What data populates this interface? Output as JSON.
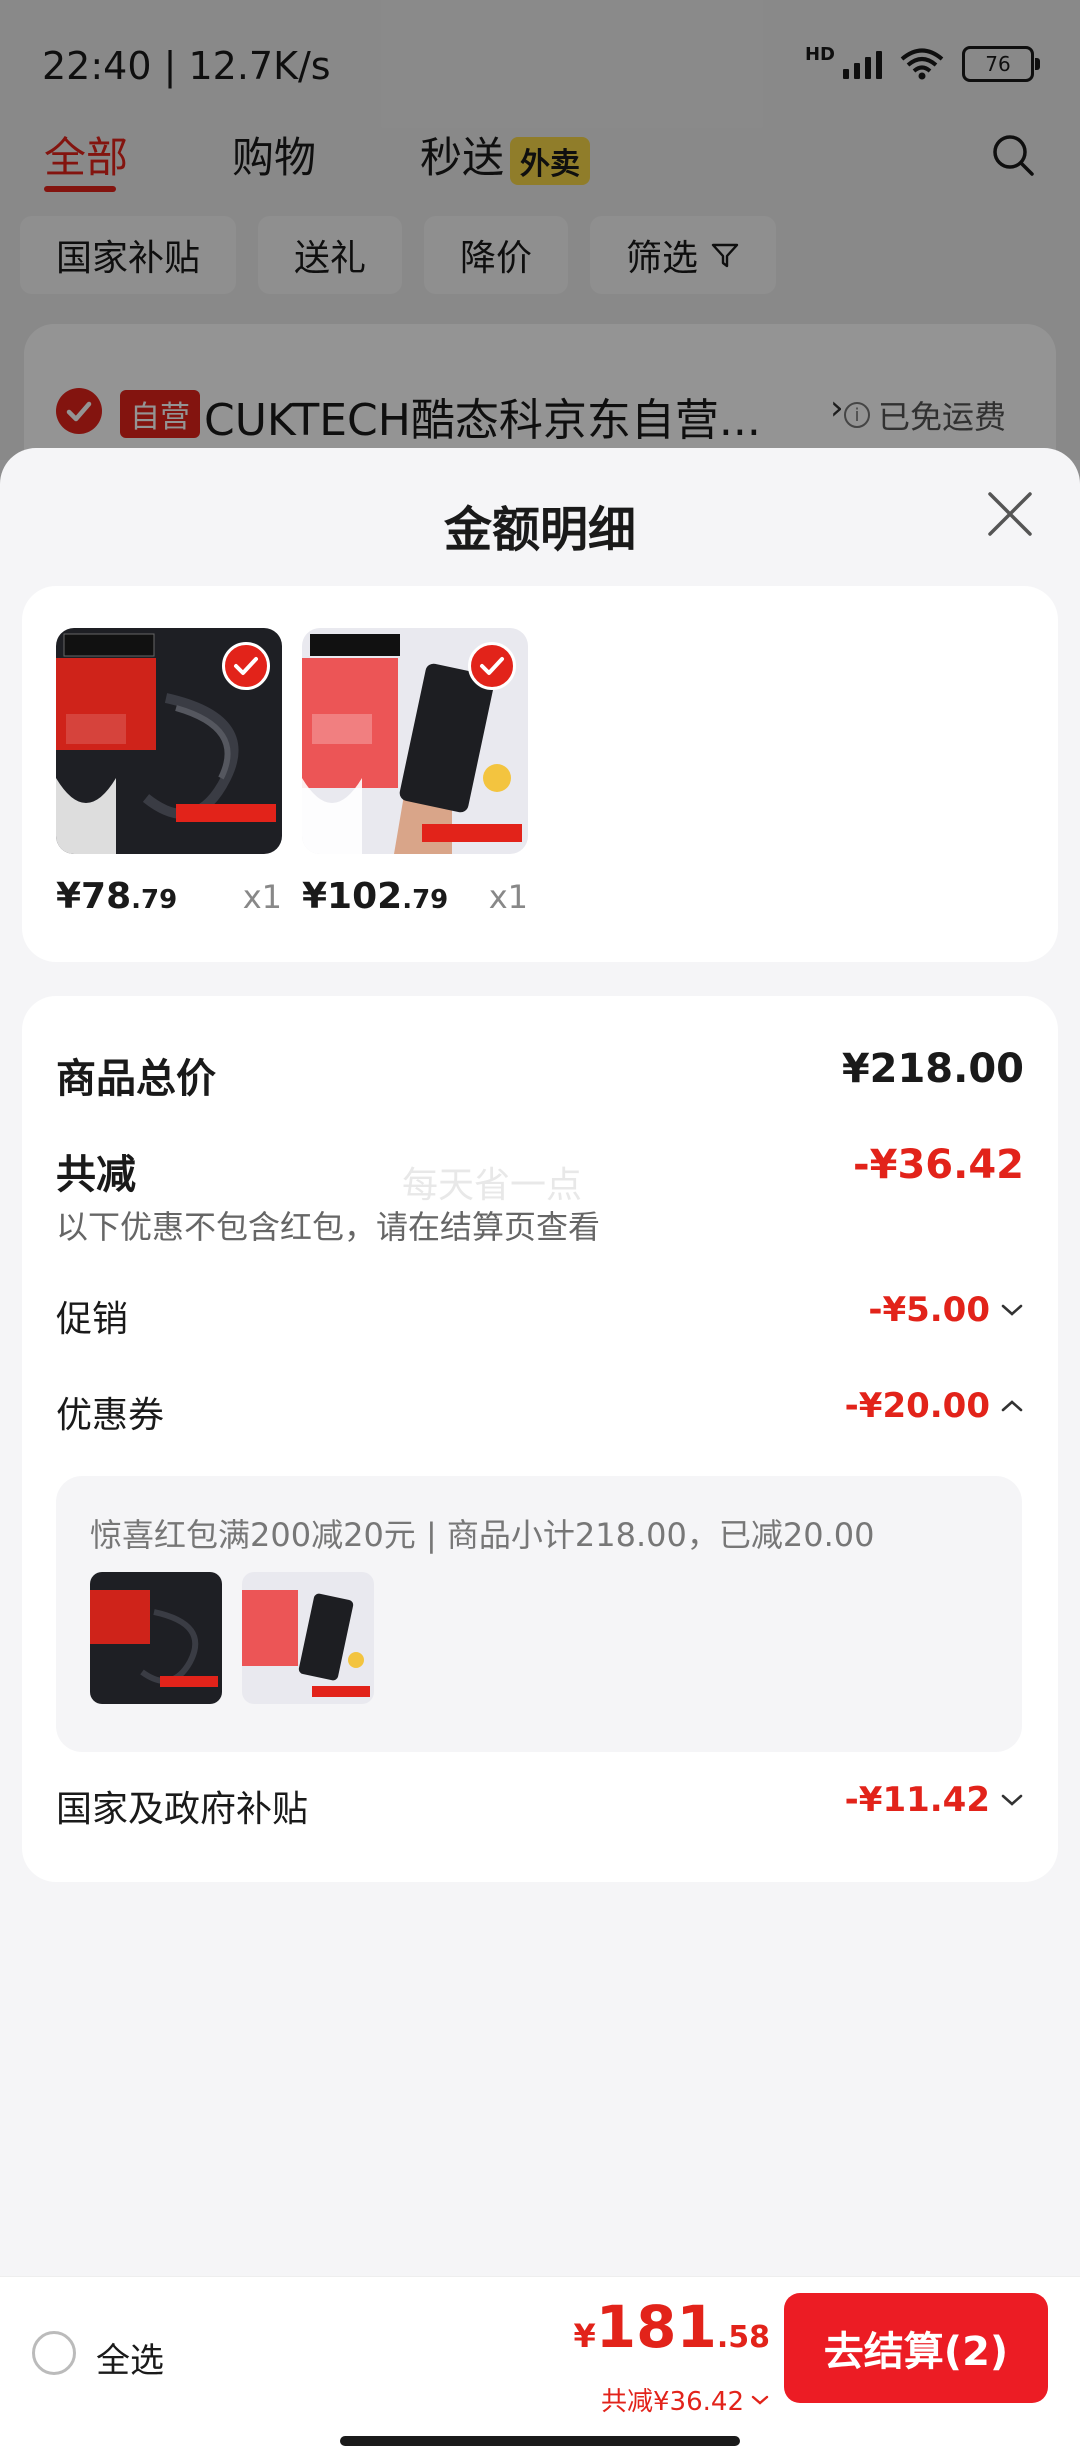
{
  "status_bar": {
    "time": "22:40 | 12.7K/s",
    "hd_label": "HD",
    "battery": "76"
  },
  "top_tabs": {
    "all": "全部",
    "shopping": "购物",
    "express": "秒送",
    "waimai_badge": "外卖"
  },
  "filters": [
    "国家补贴",
    "送礼",
    "降价",
    "筛选"
  ],
  "shop": {
    "badge": "自营",
    "name": "CUKTECH酷态科京东自营...",
    "arrow": "›",
    "freight": "已免运费"
  },
  "sheet": {
    "title": "金额明细",
    "products": [
      {
        "price_int": "¥78",
        "price_dec": ".79",
        "qty": "x1"
      },
      {
        "price_int": "¥102",
        "price_dec": ".79",
        "qty": "x1"
      }
    ],
    "total": {
      "label": "商品总价",
      "value": "¥218.00"
    },
    "reduction": {
      "label": "共减",
      "value": "-¥36.42",
      "note": "以下优惠不包含红包，请在结算页查看",
      "watermark": "每天省一点"
    },
    "promotion": {
      "label": "促销",
      "value": "-¥5.00"
    },
    "coupon": {
      "label": "优惠券",
      "value": "-¥20.00",
      "detail": "惊喜红包满200减20元 | 商品小计218.00，已减20.00"
    },
    "subsidy": {
      "label": "国家及政府补贴",
      "value": "-¥11.42"
    }
  },
  "bottom_bar": {
    "select_all": "全选",
    "price_yen": "¥",
    "price_int": "181",
    "price_dec": ".58",
    "saved": "共减¥36.42",
    "checkout": "去结算(2)"
  },
  "colors": {
    "accent": "#e2231a",
    "checkout": "#ec1c24",
    "badge_yellow": "#f8d749"
  },
  "icons": [
    "search-icon",
    "close-icon",
    "filter-icon",
    "check-icon",
    "info-icon",
    "chevron-down-icon",
    "chevron-up-icon",
    "signal-icon",
    "wifi-icon",
    "battery-icon"
  ]
}
